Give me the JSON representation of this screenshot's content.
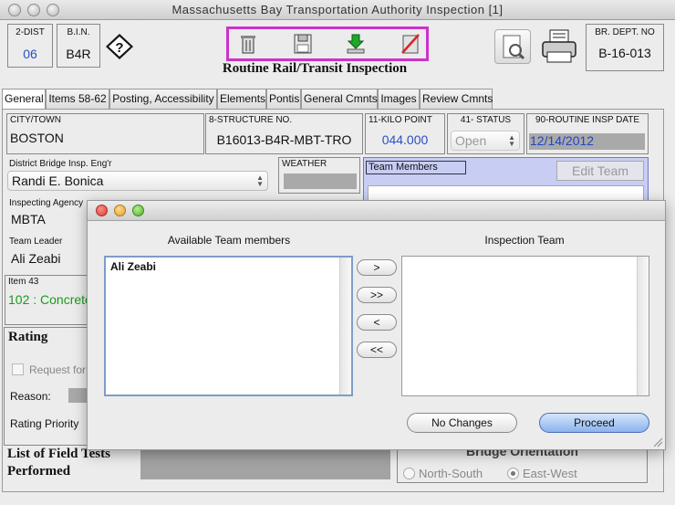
{
  "window": {
    "title": "Massachusetts Bay Transportation Authority Inspection [1]"
  },
  "header": {
    "dist": {
      "label": "2-DIST",
      "value": "06"
    },
    "bin": {
      "label": "B.I.N.",
      "value": "B4R"
    },
    "help_icon": "help-question-icon",
    "dept": {
      "label": "BR. DEPT. NO",
      "value": "B-16-013"
    },
    "heading": "Routine Rail/Transit Inspection",
    "toolbar_icons": [
      "trash-icon",
      "save-disk-icon",
      "download-arrow-icon",
      "cancel-slash-icon"
    ]
  },
  "tabs": [
    "General",
    "Items 58-62",
    "Posting, Accessibility",
    "Elements",
    "Pontis",
    "General Cmnts",
    "Images",
    "Review Cmnts"
  ],
  "general": {
    "city": {
      "label": "CITY/TOWN",
      "value": "BOSTON"
    },
    "structure": {
      "label": "8-STRUCTURE NO.",
      "value": "B16013-B4R-MBT-TRO"
    },
    "kilo": {
      "label": "11-KILO POINT",
      "value": "044.000"
    },
    "status": {
      "label": "41- STATUS",
      "value": "Open"
    },
    "insp_date": {
      "label": "90-ROUTINE INSP DATE",
      "value": "12/14/2012"
    },
    "engineer": {
      "label": "District Bridge Insp. Eng'r",
      "value": "Randi E. Bonica"
    },
    "weather": {
      "label": "WEATHER",
      "value": ""
    },
    "agency": {
      "label": "Inspecting Agency",
      "value": "MBTA"
    },
    "team_leader": {
      "label": "Team Leader",
      "value": "Ali Zeabi"
    },
    "item43": {
      "label": "Item 43",
      "value": "102 : Concrete"
    },
    "team_members": {
      "label": "Team Members",
      "edit_button": "Edit Team"
    },
    "rating": {
      "title": "Rating",
      "request_for": "Request for",
      "reason": "Reason:",
      "priority": "Rating Priority"
    },
    "field_tests": "List of Field Tests Performed",
    "orientation": {
      "title": "Bridge Orientation",
      "options": [
        "North-South",
        "East-West"
      ],
      "selected": "East-West"
    }
  },
  "dialog": {
    "available_title": "Available Team members",
    "team_title": "Inspection Team",
    "available": [
      "Ali Zeabi"
    ],
    "team": [],
    "move_buttons": [
      ">",
      ">>",
      "<",
      "<<"
    ],
    "no_changes": "No Changes",
    "proceed": "Proceed"
  }
}
